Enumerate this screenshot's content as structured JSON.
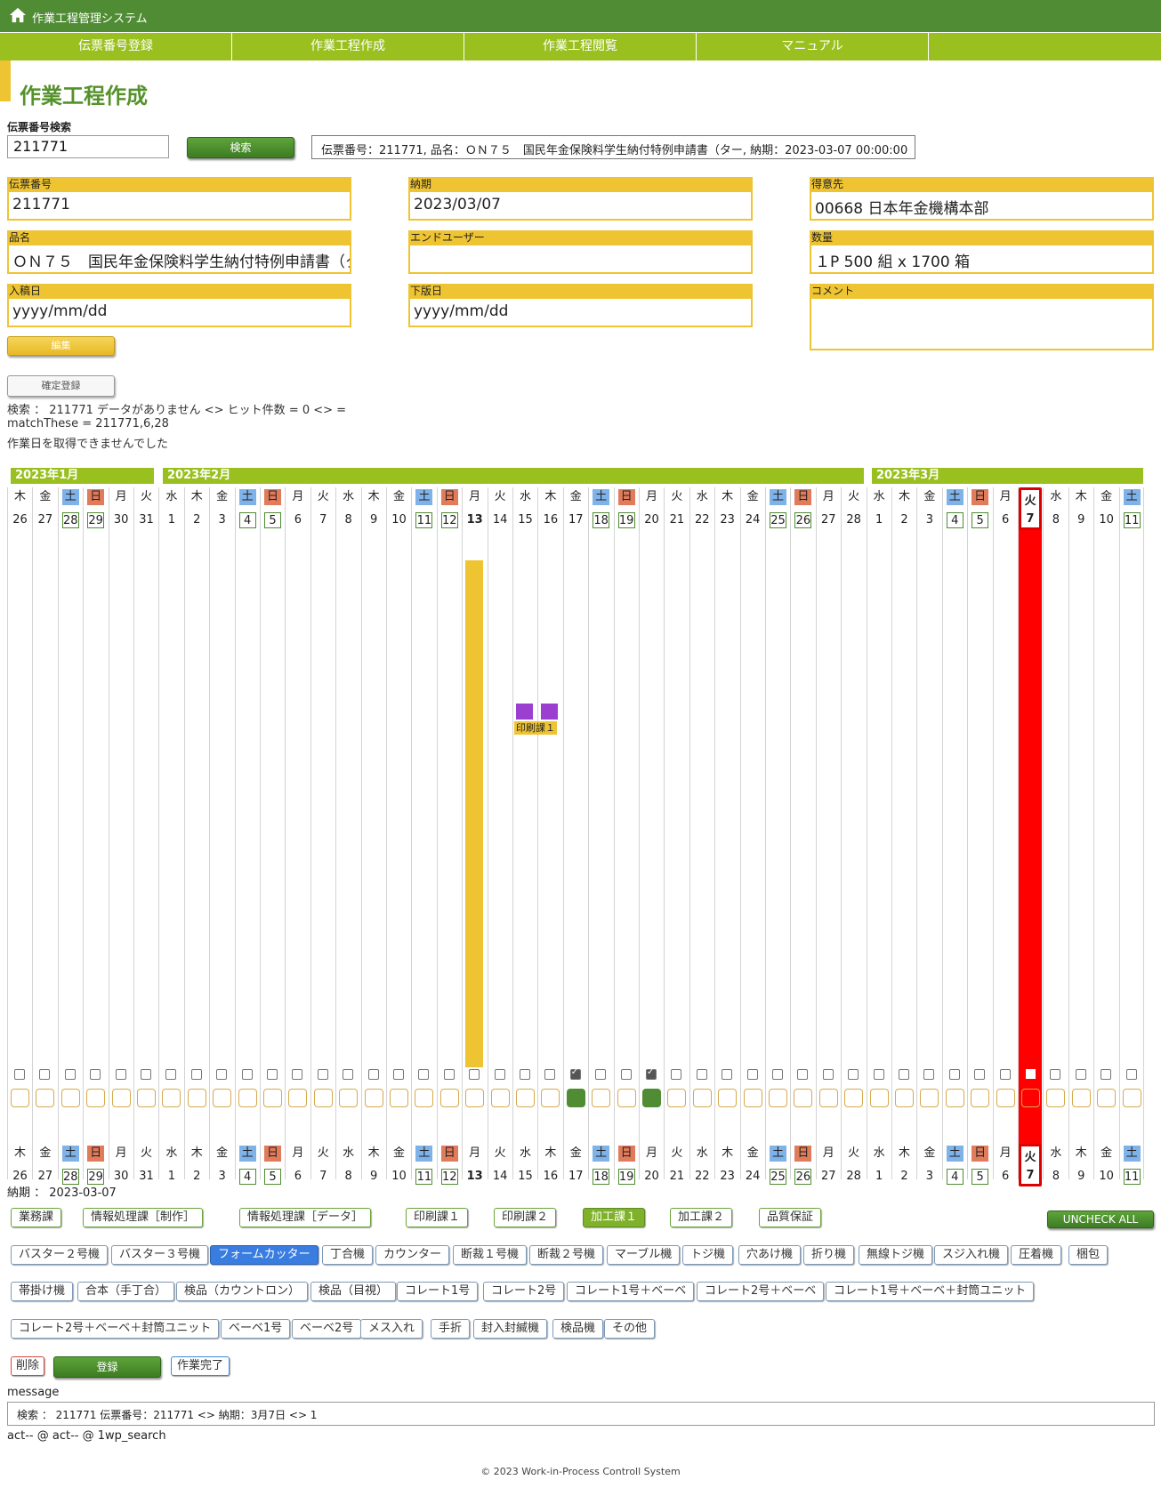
{
  "app": {
    "title": "作業工程管理システム"
  },
  "nav": [
    "伝票番号登録",
    "作業工程作成",
    "作業工程閲覧",
    "マニュアル"
  ],
  "page_title": "作業工程作成",
  "search": {
    "label": "伝票番号検索",
    "value": "211771",
    "button": "検索",
    "result": "伝票番号：211771, 品名：ＯＮ７５　国民年金保険料学生納付特例申請書（ター, 納期：2023-03-07 00:00:00"
  },
  "fields": {
    "slip_no": {
      "label": "伝票番号",
      "value": "211771"
    },
    "due": {
      "label": "納期",
      "value": "2023/03/07"
    },
    "customer": {
      "label": "得意先",
      "value": "00668 日本年金機構本部"
    },
    "product": {
      "label": "品名",
      "value": "ＯＮ７５　国民年金保険料学生納付特例申請書（ター"
    },
    "end_user": {
      "label": "エンドユーザー",
      "value": ""
    },
    "quantity": {
      "label": "数量",
      "value": "１P 500 組 x 1700 箱"
    },
    "manuscript_date": {
      "label": "入稿日",
      "value": "yyyy/mm/dd"
    },
    "plate_date": {
      "label": "下版日",
      "value": "yyyy/mm/dd"
    },
    "comment": {
      "label": "コメント",
      "value": ""
    }
  },
  "buttons": {
    "edit": "編集",
    "confirm": "確定登録"
  },
  "status_lines": [
    "検索 ： 211771 データがありません <> ヒット件数 = 0 <> =",
    "matchThese = 211771,6,28",
    "作業日を取得できませんでした"
  ],
  "months": [
    "2023年1月",
    "2023年2月",
    "2023年3月"
  ],
  "calendar": {
    "days": [
      {
        "d": "木",
        "n": "26"
      },
      {
        "d": "金",
        "n": "27"
      },
      {
        "d": "土",
        "n": "28"
      },
      {
        "d": "日",
        "n": "29"
      },
      {
        "d": "月",
        "n": "30"
      },
      {
        "d": "火",
        "n": "31"
      },
      {
        "d": "水",
        "n": "1"
      },
      {
        "d": "木",
        "n": "2"
      },
      {
        "d": "金",
        "n": "3"
      },
      {
        "d": "土",
        "n": "4"
      },
      {
        "d": "日",
        "n": "5"
      },
      {
        "d": "月",
        "n": "6"
      },
      {
        "d": "火",
        "n": "7"
      },
      {
        "d": "水",
        "n": "8"
      },
      {
        "d": "木",
        "n": "9"
      },
      {
        "d": "金",
        "n": "10"
      },
      {
        "d": "土",
        "n": "11"
      },
      {
        "d": "日",
        "n": "12"
      },
      {
        "d": "月",
        "n": "13"
      },
      {
        "d": "火",
        "n": "14"
      },
      {
        "d": "水",
        "n": "15"
      },
      {
        "d": "木",
        "n": "16"
      },
      {
        "d": "金",
        "n": "17"
      },
      {
        "d": "土",
        "n": "18"
      },
      {
        "d": "日",
        "n": "19"
      },
      {
        "d": "月",
        "n": "20"
      },
      {
        "d": "火",
        "n": "21"
      },
      {
        "d": "水",
        "n": "22"
      },
      {
        "d": "木",
        "n": "23"
      },
      {
        "d": "金",
        "n": "24"
      },
      {
        "d": "土",
        "n": "25"
      },
      {
        "d": "日",
        "n": "26"
      },
      {
        "d": "月",
        "n": "27"
      },
      {
        "d": "火",
        "n": "28"
      },
      {
        "d": "水",
        "n": "1"
      },
      {
        "d": "木",
        "n": "2"
      },
      {
        "d": "金",
        "n": "3"
      },
      {
        "d": "土",
        "n": "4"
      },
      {
        "d": "日",
        "n": "5"
      },
      {
        "d": "月",
        "n": "6"
      },
      {
        "d": "火",
        "n": "7"
      },
      {
        "d": "水",
        "n": "8"
      },
      {
        "d": "木",
        "n": "9"
      },
      {
        "d": "金",
        "n": "10"
      },
      {
        "d": "土",
        "n": "11"
      }
    ],
    "today_index": 18,
    "deadline_index": 40,
    "checked_indices": [
      22,
      25
    ],
    "green_box_indices": [
      22,
      25
    ],
    "events": [
      {
        "label": "印刷課１",
        "start_index": 20,
        "end_index": 21,
        "color": "#9b3fd0"
      }
    ],
    "bar_color": "#efc433",
    "deadline_color": "#ff0000"
  },
  "deadline_text": "納期 ： 2023-03-07",
  "departments": [
    "業務課",
    "情報処理課［制作］",
    "情報処理課［データ］",
    "印刷課１",
    "印刷課２",
    "加工課１",
    "加工課２",
    "品質保証"
  ],
  "uncheck_all": "UNCHECK ALL",
  "machines_row1": [
    "バスター２号機",
    "バスター３号機",
    "フォームカッター",
    "丁合機",
    "カウンター",
    "断裁１号機",
    "断裁２号機",
    "マーブル機",
    "トジ機",
    "穴あけ機",
    "折り機",
    "無線トジ機",
    "スジ入れ機",
    "圧着機",
    "梱包"
  ],
  "machines_row2": [
    "帯掛け機",
    "合本（手丁合）",
    "検品（カウントロン）",
    "検品（目視）",
    "コレート1号",
    "コレート2号",
    "コレート1号＋ベーベ",
    "コレート2号＋ベーベ",
    "コレート1号＋ベーベ＋封筒ユニット"
  ],
  "machines_row3": [
    "コレート2号＋ベーベ＋封筒ユニット",
    "ベーベ1号",
    "ベーベ2号",
    "メス入れ",
    "手折",
    "封入封緘機",
    "検品機",
    "その他"
  ],
  "actions": {
    "delete": "削除",
    "register": "登録",
    "complete": "作業完了"
  },
  "message": {
    "label": "message",
    "text": "検索 ： 211771 伝票番号：211771 <> 納期：3月7日 <> 1"
  },
  "act_line": "act-- @ act-- @ 1wp_search",
  "footer": "© 2023 Work-in-Process Controll System"
}
